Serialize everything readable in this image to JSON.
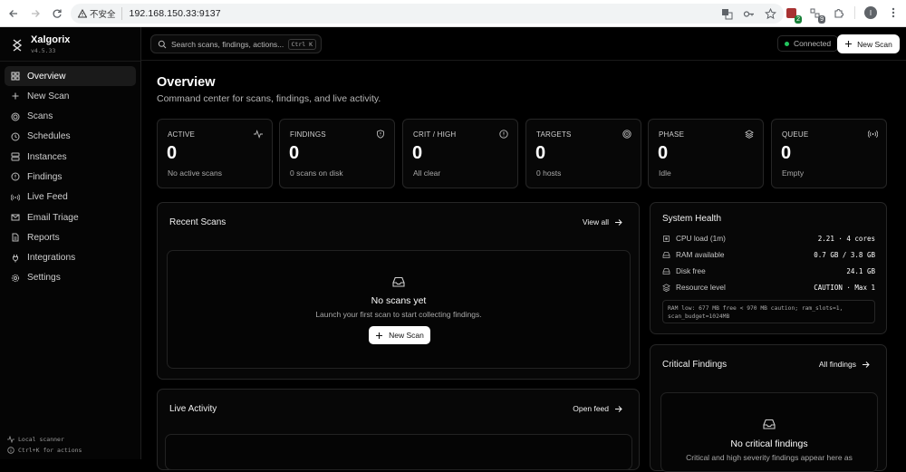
{
  "browser": {
    "security_label": "不安全",
    "url": "192.168.150.33:9137",
    "ext_badge_1": "2",
    "ext_badge_2": "9",
    "profile_initial": "I"
  },
  "sidebar": {
    "app_name": "Xalgorix",
    "version": "v4.5.33",
    "items": [
      {
        "label": "Overview",
        "icon": "grid-icon"
      },
      {
        "label": "New Scan",
        "icon": "plus-icon"
      },
      {
        "label": "Scans",
        "icon": "target-icon"
      },
      {
        "label": "Schedules",
        "icon": "clock-icon"
      },
      {
        "label": "Instances",
        "icon": "server-icon"
      },
      {
        "label": "Findings",
        "icon": "shield-icon"
      },
      {
        "label": "Live Feed",
        "icon": "radio-icon"
      },
      {
        "label": "Email Triage",
        "icon": "mail-icon"
      },
      {
        "label": "Reports",
        "icon": "file-icon"
      },
      {
        "label": "Integrations",
        "icon": "plug-icon"
      },
      {
        "label": "Settings",
        "icon": "gear-icon"
      }
    ],
    "footer_scanner": "Local scanner",
    "footer_hint": "Ctrl+K for actions"
  },
  "topbar": {
    "search_placeholder": "Search scans, findings, actions...",
    "shortcut": "Ctrl K",
    "connection_status": "Connected",
    "new_scan_label": "New Scan"
  },
  "overview": {
    "title": "Overview",
    "subtitle": "Command center for scans, findings, and live activity.",
    "stats": [
      {
        "label": "ACTIVE",
        "value": "0",
        "desc": "No active scans",
        "icon": "activity-icon"
      },
      {
        "label": "FINDINGS",
        "value": "0",
        "desc": "0 scans on disk",
        "icon": "shield-icon"
      },
      {
        "label": "CRIT / HIGH",
        "value": "0",
        "desc": "All clear",
        "icon": "alert-circle-icon"
      },
      {
        "label": "TARGETS",
        "value": "0",
        "desc": "0 hosts",
        "icon": "target-icon"
      },
      {
        "label": "PHASE",
        "value": "0",
        "desc": "Idle",
        "icon": "layers-icon"
      },
      {
        "label": "QUEUE",
        "value": "0",
        "desc": "Empty",
        "icon": "radio-icon"
      }
    ]
  },
  "recent_scans": {
    "title": "Recent Scans",
    "link": "View all",
    "empty_title": "No scans yet",
    "empty_desc": "Launch your first scan to start collecting findings.",
    "button": "New Scan"
  },
  "live_activity": {
    "title": "Live Activity",
    "link": "Open feed"
  },
  "system_health": {
    "title": "System Health",
    "rows": [
      {
        "label": "CPU load (1m)",
        "value": "2.21 · 4 cores",
        "icon": "cpu-icon"
      },
      {
        "label": "RAM available",
        "value": "0.7 GB / 3.8 GB",
        "icon": "hdd-icon"
      },
      {
        "label": "Disk free",
        "value": "24.1 GB",
        "icon": "disk-icon"
      },
      {
        "label": "Resource level",
        "value": "CAUTION · Max 1",
        "icon": "layers-icon"
      }
    ],
    "note": "RAM low: 677 MB free < 970 MB caution; ram_slots=1, scan_budget=1024MB"
  },
  "critical_findings": {
    "title": "Critical Findings",
    "link": "All findings",
    "empty_title": "No critical findings",
    "empty_desc": "Critical and high severity findings appear here as"
  }
}
